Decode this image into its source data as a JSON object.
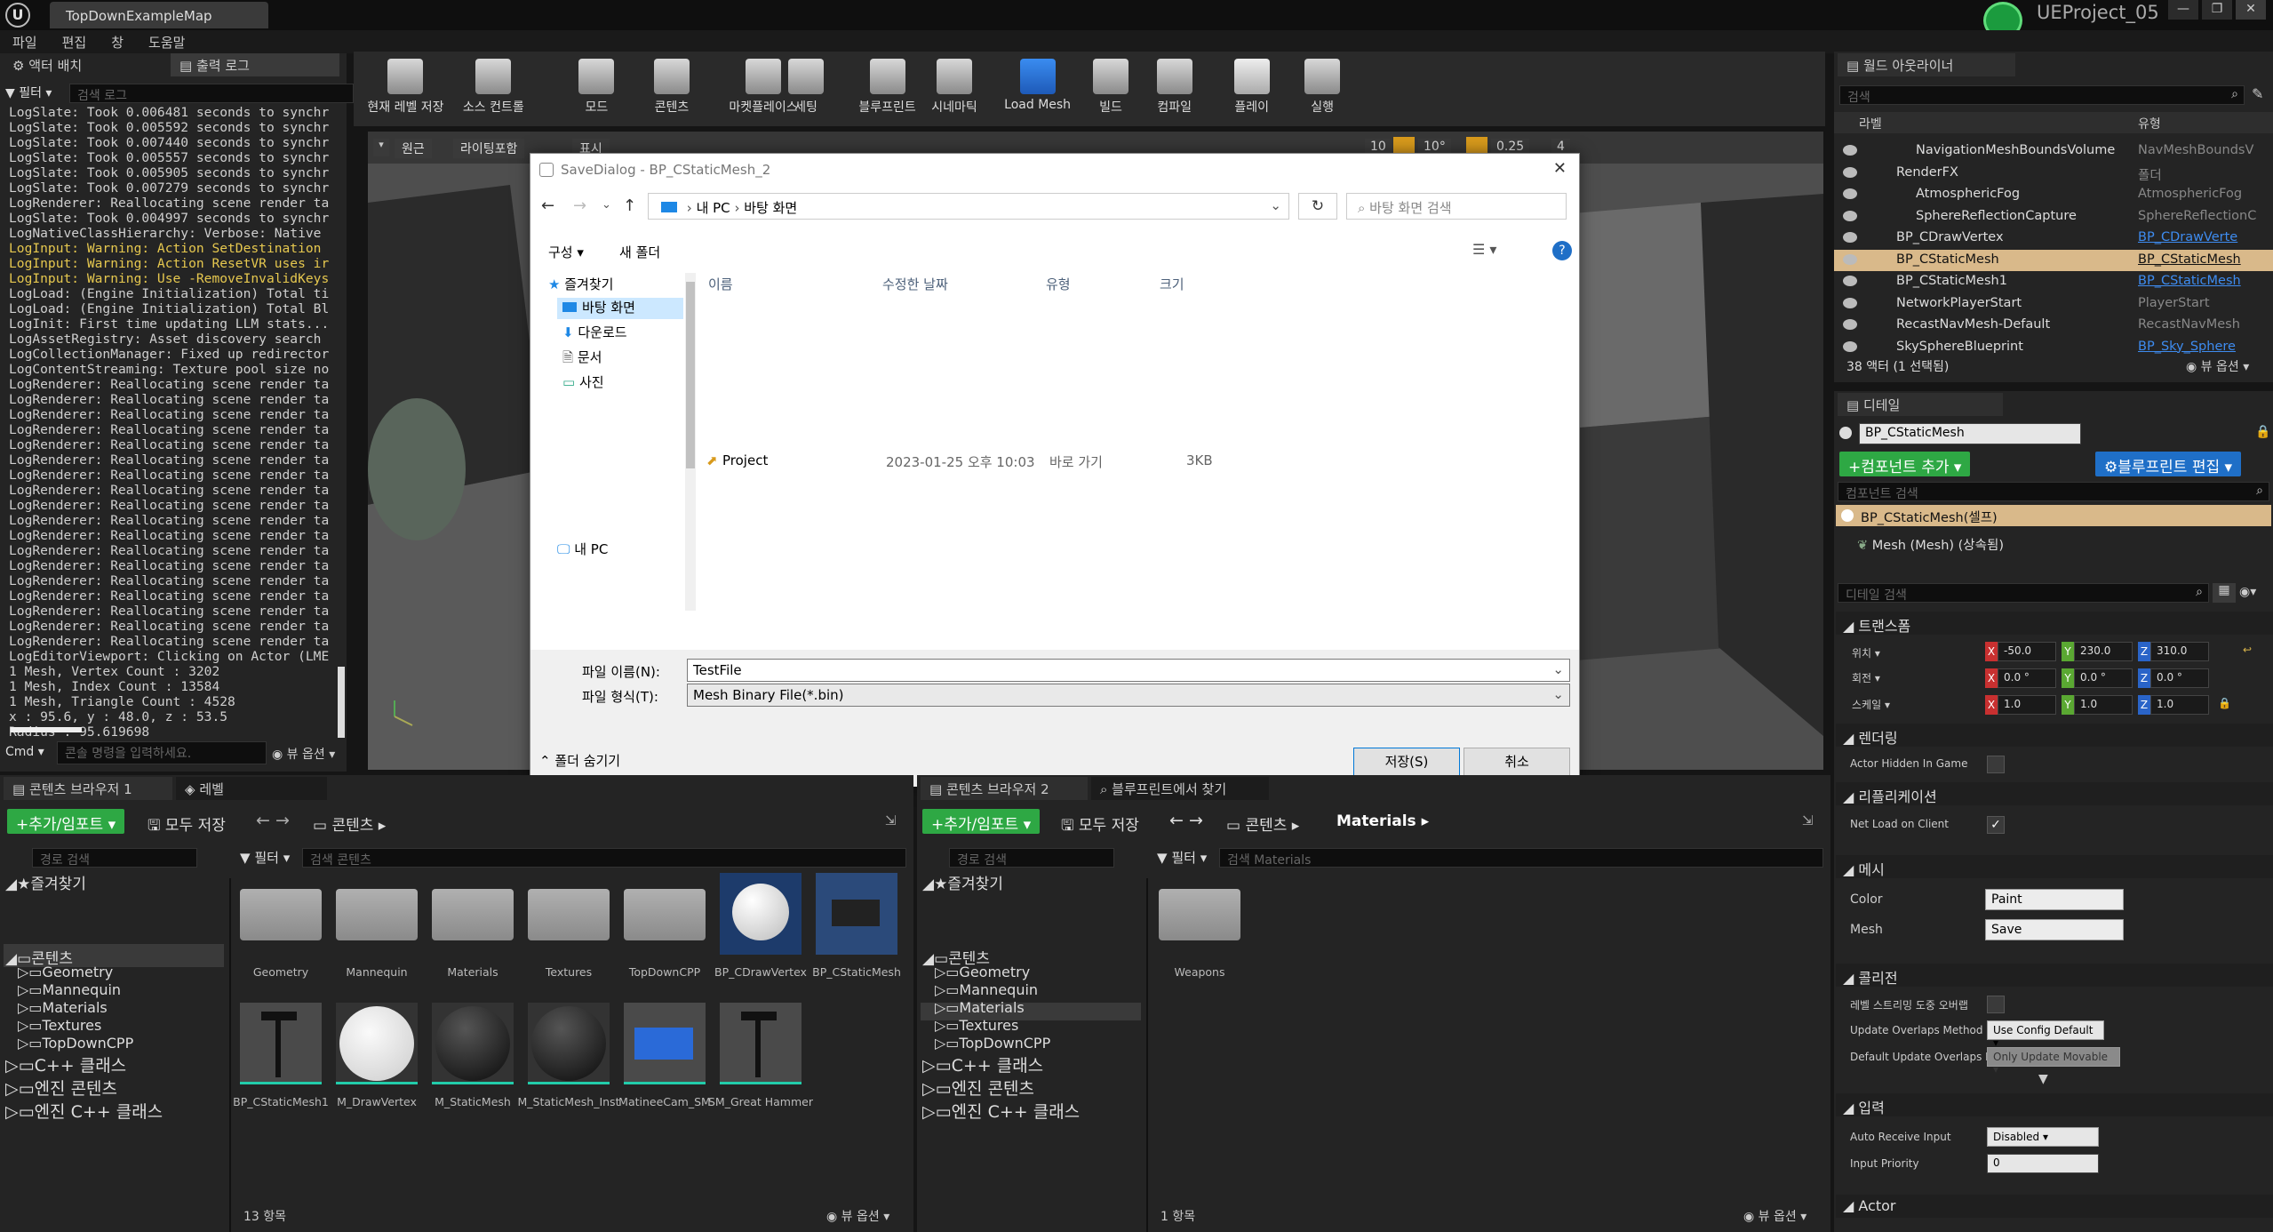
{
  "window": {
    "tab_title": "TopDownExampleMap",
    "project_name": "UEProject_05",
    "controls": [
      "—",
      "❐",
      "✕"
    ]
  },
  "menu": [
    "파일",
    "편집",
    "창",
    "도움말"
  ],
  "left_panel": {
    "tabs": [
      "액터 배치",
      "출력 로그"
    ],
    "filter_label": "필터",
    "search_placeholder": "검색 로그",
    "log_lines": [
      "LogSlate: Took 0.006481 seconds to synchr",
      "LogSlate: Took 0.005592 seconds to synchr",
      "LogSlate: Took 0.007440 seconds to synchr",
      "LogSlate: Took 0.005557 seconds to synchr",
      "LogSlate: Took 0.005905 seconds to synchr",
      "LogSlate: Took 0.007279 seconds to synchr",
      "LogRenderer: Reallocating scene render ta",
      "LogSlate: Took 0.004997 seconds to synchr",
      "LogNativeClassHierarchy: Verbose: Native",
      "LogInput: Warning: Action SetDestination",
      "LogInput: Warning: Action ResetVR uses ir",
      "LogInput: Warning: Use -RemoveInvalidKeys",
      "LogLoad: (Engine Initialization) Total ti",
      "LogLoad: (Engine Initialization) Total Bl",
      "LogInit: First time updating LLM stats...",
      "LogAssetRegistry: Asset discovery search",
      "LogCollectionManager: Fixed up redirector",
      "LogContentStreaming: Texture pool size no",
      "LogRenderer: Reallocating scene render ta",
      "LogRenderer: Reallocating scene render ta",
      "LogRenderer: Reallocating scene render ta",
      "LogRenderer: Reallocating scene render ta",
      "LogRenderer: Reallocating scene render ta",
      "LogRenderer: Reallocating scene render ta",
      "LogRenderer: Reallocating scene render ta",
      "LogRenderer: Reallocating scene render ta",
      "LogRenderer: Reallocating scene render ta",
      "LogRenderer: Reallocating scene render ta",
      "LogRenderer: Reallocating scene render ta",
      "LogRenderer: Reallocating scene render ta",
      "LogRenderer: Reallocating scene render ta",
      "LogRenderer: Reallocating scene render ta",
      "LogRenderer: Reallocating scene render ta",
      "LogRenderer: Reallocating scene render ta",
      "LogRenderer: Reallocating scene render ta",
      "LogRenderer: Reallocating scene render ta",
      "LogEditorViewport: Clicking on Actor (LME",
      "1 Mesh, Vertex Count : 3202",
      "1 Mesh, Index Count : 13584",
      "1 Mesh, Triangle Count : 4528",
      "x : 95.6, y : 48.0, z : 53.5",
      "Radius : 95.619698"
    ],
    "warning_line_indices": [
      9,
      10,
      11
    ],
    "cmd_label": "Cmd",
    "cmd_placeholder": "콘솔 명령을 입력하세요.",
    "view_options": "뷰 옵션"
  },
  "toolbar": [
    {
      "label": "현재 레벨 저장",
      "icon": "save-icon"
    },
    {
      "label": "소스 컨트롤",
      "icon": "source-control-icon"
    },
    {
      "label": "모드",
      "icon": "modes-icon"
    },
    {
      "label": "콘텐츠",
      "icon": "content-icon"
    },
    {
      "label": "마켓플레이스",
      "icon": "marketplace-icon"
    },
    {
      "label": "세팅",
      "icon": "settings-icon"
    },
    {
      "label": "블루프린트",
      "icon": "blueprint-icon"
    },
    {
      "label": "시네마틱",
      "icon": "cinematics-icon"
    },
    {
      "label": "Load Mesh",
      "icon": "cube-icon"
    },
    {
      "label": "빌드",
      "icon": "build-icon"
    },
    {
      "label": "컴파일",
      "icon": "compile-icon"
    },
    {
      "label": "플레이",
      "icon": "play-icon"
    },
    {
      "label": "실행",
      "icon": "launch-icon"
    }
  ],
  "viewport": {
    "perspective": "원근",
    "lighting": "라이팅포함",
    "show": "표시",
    "grid_value": "10",
    "angle_value": "10°",
    "scale_value": "0.25",
    "camera_speed": "4"
  },
  "dialog": {
    "title": "SaveDialog - BP_CStaticMesh_2",
    "breadcrumb": [
      "내 PC",
      "바탕 화면"
    ],
    "search_placeholder": "바탕 화면 검색",
    "organize": "구성",
    "new_folder": "새 폴더",
    "nav": {
      "quick_access": "즐겨찾기",
      "items": [
        "바탕 화면",
        "다운로드",
        "문서",
        "사진"
      ],
      "this_pc": "내 PC"
    },
    "columns": [
      "이름",
      "수정한 날짜",
      "유형",
      "크기"
    ],
    "files": [
      {
        "name": "Project",
        "modified": "2023-01-25 오후 10:03",
        "type": "바로 가기",
        "size": "3KB"
      }
    ],
    "filename_label": "파일 이름(N):",
    "filename_value": "TestFile",
    "filetype_label": "파일 형식(T):",
    "filetype_value": "Mesh Binary File(*.bin)",
    "hide_folders": "폴더 숨기기",
    "save_button": "저장(S)",
    "cancel_button": "취소"
  },
  "outliner": {
    "tab": "월드 아웃라이너",
    "search_placeholder": "검색",
    "col_label": "라벨",
    "col_type": "유형",
    "rows": [
      {
        "label": "NavigationMeshBoundsVolume",
        "type": "NavMeshBoundsV",
        "link": false,
        "indent": 2
      },
      {
        "label": "RenderFX",
        "type": "폴더",
        "link": false,
        "indent": 1
      },
      {
        "label": "AtmosphericFog",
        "type": "AtmosphericFog",
        "link": false,
        "indent": 2
      },
      {
        "label": "SphereReflectionCapture",
        "type": "SphereReflectionC",
        "link": false,
        "indent": 2
      },
      {
        "label": "BP_CDrawVertex",
        "type": "BP_CDrawVerte",
        "link": true,
        "indent": 1
      },
      {
        "label": "BP_CStaticMesh",
        "type": "BP_CStaticMesh",
        "link": true,
        "indent": 1,
        "selected": true
      },
      {
        "label": "BP_CStaticMesh1",
        "type": "BP_CStaticMesh",
        "link": true,
        "indent": 1
      },
      {
        "label": "NetworkPlayerStart",
        "type": "PlayerStart",
        "link": false,
        "indent": 1
      },
      {
        "label": "RecastNavMesh-Default",
        "type": "RecastNavMesh",
        "link": false,
        "indent": 1
      },
      {
        "label": "SkySphereBlueprint",
        "type": "BP_Sky_Sphere",
        "link": true,
        "indent": 1
      }
    ],
    "count_text": "38 액터 (1 선택됨)",
    "view_options": "뷰 옵션"
  },
  "details": {
    "tab": "디테일",
    "actor_name": "BP_CStaticMesh",
    "add_component": "컴포넌트 추가",
    "edit_blueprint": "블루프린트 편집",
    "component_search": "컴포넌트 검색",
    "self_component": "BP_CStaticMesh(셀프)",
    "mesh_component": "Mesh (Mesh) (상속됨)",
    "details_search": "디테일 검색",
    "transform_section": "트랜스폼",
    "location_label": "위치",
    "rotation_label": "회전",
    "scale_label": "스케일",
    "location": [
      "-50.0",
      "230.0",
      "310.0"
    ],
    "rotation": [
      "0.0 °",
      "0.0 °",
      "0.0 °"
    ],
    "scale": [
      "1.0",
      "1.0",
      "1.0"
    ],
    "axis_letters": [
      "X",
      "Y",
      "Z"
    ],
    "rendering_section": "렌더링",
    "actor_hidden": "Actor Hidden In Game",
    "replication_section": "리플리케이션",
    "net_load": "Net Load on Client",
    "mesh_section": "메시",
    "color_label": "Color",
    "color_value": "Paint",
    "mesh_label": "Mesh",
    "mesh_value": "Save",
    "collision_section": "콜리전",
    "overlap_stream": "레벨 스트리밍 도중 오버랩",
    "update_overlaps_label": "Update Overlaps Method",
    "update_overlaps_value": "Use Config Default",
    "default_update_label": "Default Update Overlaps I",
    "default_update_value": "Only Update Movable",
    "input_section": "입력",
    "auto_receive_label": "Auto Receive Input",
    "auto_receive_value": "Disabled",
    "input_priority_label": "Input Priority",
    "input_priority_value": "0",
    "actor_section": "Actor"
  },
  "content_browser_1": {
    "tabs": [
      "콘텐츠 브라우저 1",
      "레벨"
    ],
    "add_import": "추가/임포트",
    "save_all": "모두 저장",
    "path_root": "콘텐츠",
    "path_search": "경로 검색",
    "filter": "필터",
    "content_search": "검색 콘텐츠",
    "favorites": "즐겨찾기",
    "tree_root": "콘텐츠",
    "tree_children": [
      "Geometry",
      "Mannequin",
      "Materials",
      "Textures",
      "TopDownCPP"
    ],
    "tree_extra": [
      "C++ 클래스",
      "엔진 콘텐츠",
      "엔진 C++ 클래스"
    ],
    "assets_row1": [
      "Geometry",
      "Mannequin",
      "Materials",
      "Textures",
      "TopDownCPP",
      "BP_CDrawVertex",
      "BP_CStaticMesh"
    ],
    "assets_row2": [
      "BP_CStaticMesh1",
      "M_DrawVertex",
      "M_StaticMesh",
      "M_StaticMesh_Inst",
      "MatineeCam_SM",
      "SM_Great Hammer"
    ],
    "count": "13 항목",
    "view_options": "뷰 옵션"
  },
  "content_browser_2": {
    "tabs": [
      "콘텐츠 브라우저 2",
      "블루프린트에서 찾기"
    ],
    "add_import": "추가/임포트",
    "save_all": "모두 저장",
    "path_root": "콘텐츠",
    "path_current": "Materials",
    "path_search": "경로 검색",
    "filter": "필터",
    "content_search": "검색 Materials",
    "favorites": "즐겨찾기",
    "tree_root": "콘텐츠",
    "tree_children": [
      "Geometry",
      "Mannequin",
      "Materials",
      "Textures",
      "TopDownCPP"
    ],
    "tree_extra": [
      "C++ 클래스",
      "엔진 콘텐츠",
      "엔진 C++ 클래스"
    ],
    "assets": [
      "Weapons"
    ],
    "count": "1 항목",
    "view_options": "뷰 옵션"
  }
}
